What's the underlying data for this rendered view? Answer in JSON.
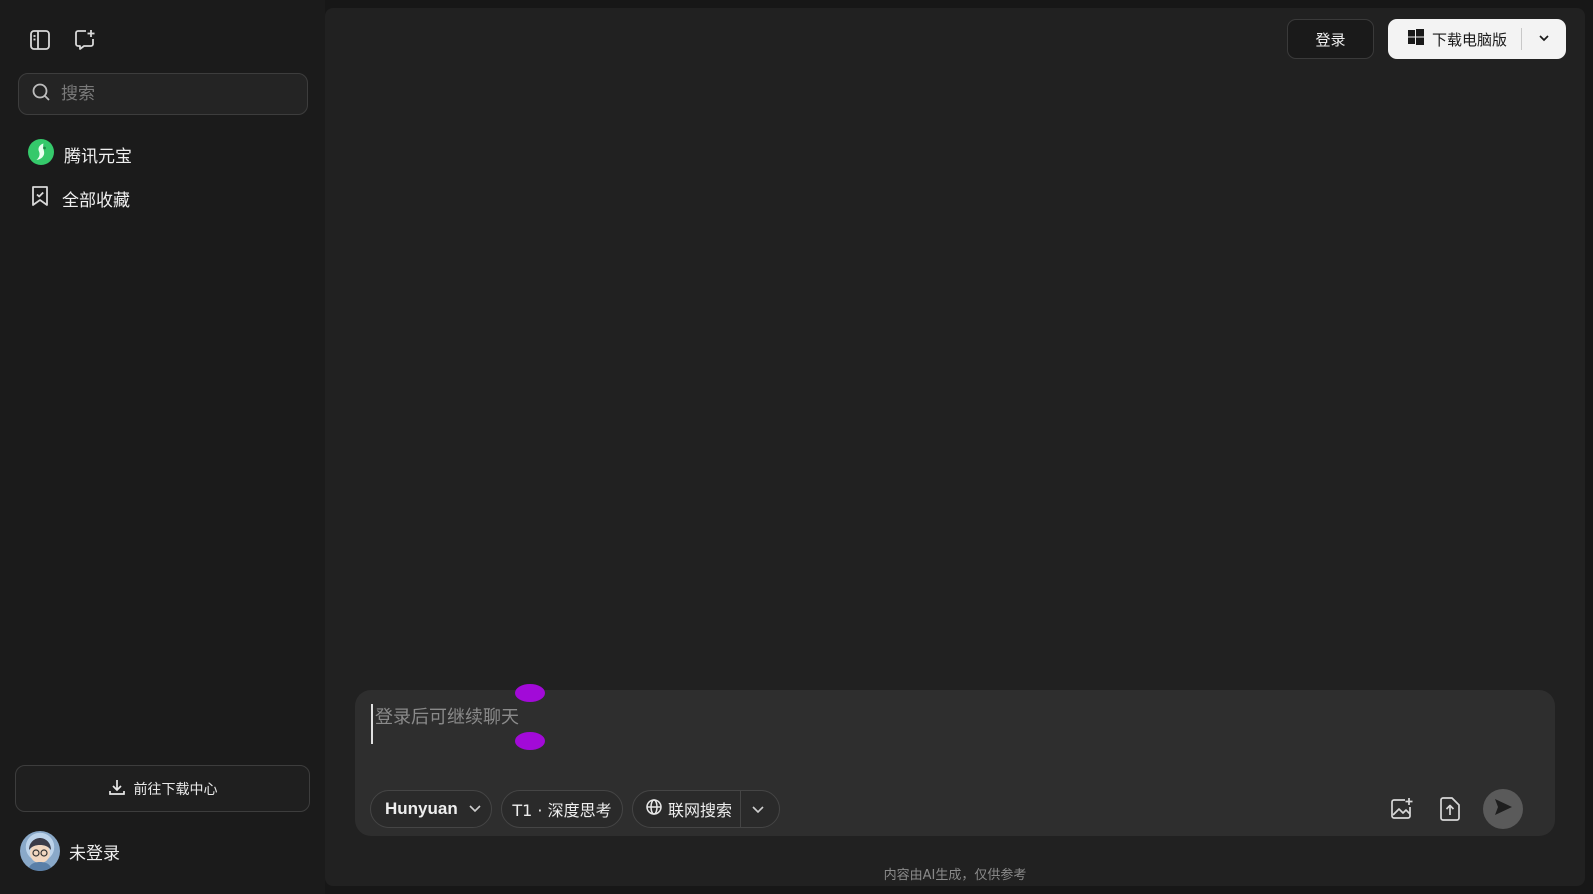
{
  "sidebar": {
    "search_placeholder": "搜索",
    "items": [
      {
        "label": "腾讯元宝",
        "icon": "yuanbao-logo-icon"
      },
      {
        "label": "全部收藏",
        "icon": "bookmark-icon"
      }
    ],
    "download_center_label": "前往下载中心",
    "user_label": "未登录"
  },
  "header": {
    "login_label": "登录",
    "download_label": "下载电脑版"
  },
  "composer": {
    "placeholder": "登录后可继续聊天",
    "model_label": "Hunyuan",
    "think_label": "T1 · 深度思考",
    "web_search_label": "联网搜索"
  },
  "footer": {
    "disclaimer": "内容由AI生成，仅供参考"
  },
  "colors": {
    "brand_green": "#35c96b",
    "selection_handle": "#a20ad8",
    "send_disabled": "#5a5a5a"
  }
}
